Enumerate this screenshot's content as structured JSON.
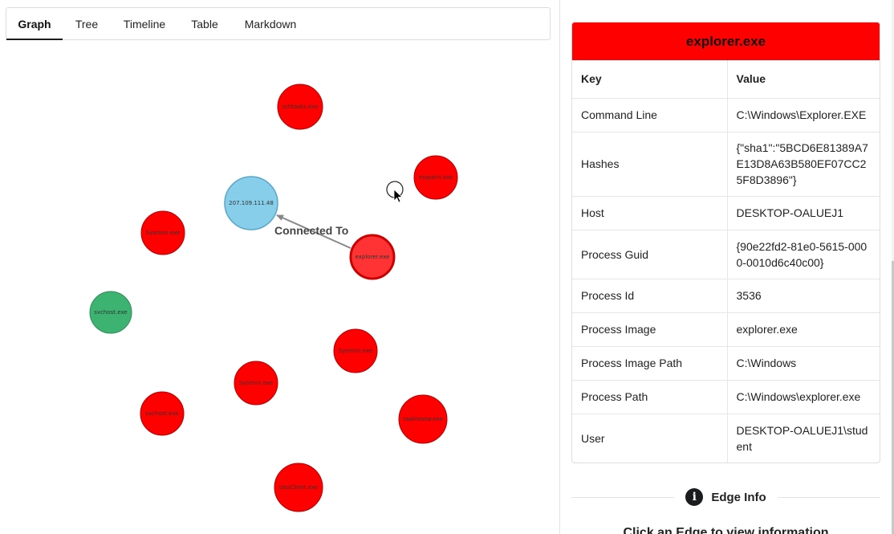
{
  "tabs": [
    {
      "label": "Graph",
      "active": true
    },
    {
      "label": "Tree"
    },
    {
      "label": "Timeline"
    },
    {
      "label": "Table"
    },
    {
      "label": "Markdown"
    }
  ],
  "graph": {
    "nodes": {
      "schtasks": "schtasks.exe",
      "mspaint": "mspaint.exe",
      "ip": "207.109.111.48",
      "sysmon1": "Sysmon.exe",
      "explorer": "explorer.exe",
      "svchost_green": "svchost.exe",
      "sysmon2": "Sysmon.exe",
      "sysmon3": "Sysmon.exe",
      "svchost_red": "svchost.exe",
      "taskhostw": "taskhostw.exe",
      "usoclient": "UsoClient.exe"
    },
    "edge_label": "Connected To",
    "colors": {
      "process": "#ff0000",
      "selected": "#ff3333",
      "ip": "#87ceeb",
      "green": "#3cb371"
    }
  },
  "details": {
    "title": "explorer.exe",
    "columns": {
      "key": "Key",
      "value": "Value"
    },
    "rows": [
      {
        "key": "Command Line",
        "value": "C:\\Windows\\Explorer.EXE"
      },
      {
        "key": "Hashes",
        "value": "{\"sha1\":\"5BCD6E81389A7E13D8A63B580EF07CC25F8D3896\"}"
      },
      {
        "key": "Host",
        "value": "DESKTOP-OALUEJ1"
      },
      {
        "key": "Process Guid",
        "value": "{90e22fd2-81e0-5615-0000-0010d6c40c00}"
      },
      {
        "key": "Process Id",
        "value": "3536"
      },
      {
        "key": "Process Image",
        "value": "explorer.exe"
      },
      {
        "key": "Process Image Path",
        "value": "C:\\Windows"
      },
      {
        "key": "Process Path",
        "value": "C:\\Windows\\explorer.exe"
      },
      {
        "key": "User",
        "value": "DESKTOP-OALUEJ1\\student"
      }
    ]
  },
  "edge_info": {
    "title": "Edge Info",
    "message": "Click an Edge to view information"
  }
}
